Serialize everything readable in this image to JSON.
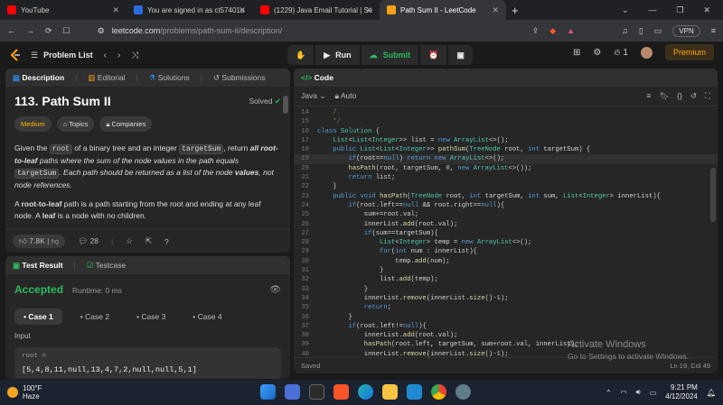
{
  "browser": {
    "tabs": [
      {
        "label": "YouTube",
        "color": "#ff0000"
      },
      {
        "label": "You are signed in as ct57401u",
        "color": "#2d6cdf"
      },
      {
        "label": "(1229) Java Email Tutorial | Sending ...",
        "color": "#ff0000"
      },
      {
        "label": "Path Sum II - LeetCode",
        "color": "#ffa116"
      }
    ],
    "new_tab": "+",
    "url_host": "leetcode.com",
    "url_path": "/problems/path-sum-ii/description/",
    "vpn_label": "VPN"
  },
  "lc_header": {
    "problem_list": "Problem List",
    "run_label": "Run",
    "submit_label": "Submit",
    "streak": "1",
    "premium": "Premium"
  },
  "left_tabs": {
    "description": "Description",
    "editorial": "Editorial",
    "solutions": "Solutions",
    "submissions": "Submissions"
  },
  "problem": {
    "title": "113. Path Sum II",
    "status": "Solved",
    "difficulty": "Medium",
    "topics": "Topics",
    "companies": "Companies",
    "p1_a": "Given the ",
    "p1_root": "root",
    "p1_b": " of a binary tree and an integer ",
    "p1_target": "targetSum",
    "p1_c": ", return ",
    "p1_d": "all root-to-leaf",
    "p1_e": " paths where the sum of the node values in the path equals ",
    "p1_target2": "targetSum",
    "p1_f": ". Each path should be returned as a list of the node ",
    "p1_g": "values",
    "p1_h": ", not node references.",
    "p2_a": "A ",
    "p2_b": "root-to-leaf",
    "p2_c": " path is a path starting from the root and ending at any leaf node. A ",
    "p2_d": "leaf",
    "p2_e": " is a node with no children.",
    "likes": "7.8K",
    "comments": "28"
  },
  "testpanel": {
    "tab_result": "Test Result",
    "tab_testcase": "Testcase",
    "verdict": "Accepted",
    "runtime": "Runtime: 0 ms",
    "cases": [
      "Case 1",
      "Case 2",
      "Case 3",
      "Case 4"
    ],
    "input_label": "Input",
    "input_name": "root =",
    "input_value": "[5,4,8,11,null,13,4,7,2,null,null,5,1]"
  },
  "editor": {
    "title": "Code",
    "language": "Java",
    "mode": "Auto",
    "saved": "Saved",
    "cursor": "Ln 19, Col 49"
  },
  "code_lines": [
    {
      "n": "14",
      "t": "    /"
    },
    {
      "n": "15",
      "t": "    */"
    },
    {
      "n": "16",
      "t": "class Solution {"
    },
    {
      "n": "17",
      "t": "    List<List<Integer>> list = new ArrayList<>();"
    },
    {
      "n": "18",
      "t": "    public List<List<Integer>> pathSum(TreeNode root, int targetSum) {"
    },
    {
      "n": "19",
      "t": "        if(root==null) return new ArrayList<>();"
    },
    {
      "n": "20",
      "t": "        hasPath(root, targetSum, 0, new ArrayList<>());"
    },
    {
      "n": "21",
      "t": "        return list;"
    },
    {
      "n": "22",
      "t": "    }"
    },
    {
      "n": "23",
      "t": "    public void hasPath(TreeNode root, int targetSum, int sum, List<Integer> innerList){"
    },
    {
      "n": "24",
      "t": "        if(root.left==null && root.right==null){"
    },
    {
      "n": "25",
      "t": "            sum+=root.val;"
    },
    {
      "n": "26",
      "t": "            innerList.add(root.val);"
    },
    {
      "n": "27",
      "t": "            if(sum==targetSum){"
    },
    {
      "n": "28",
      "t": "                List<Integer> temp = new ArrayList<>();"
    },
    {
      "n": "29",
      "t": "                for(int num : innerList){"
    },
    {
      "n": "30",
      "t": "                    temp.add(num);"
    },
    {
      "n": "31",
      "t": "                }"
    },
    {
      "n": "32",
      "t": "                list.add(temp);"
    },
    {
      "n": "33",
      "t": "            }"
    },
    {
      "n": "34",
      "t": "            innerList.remove(innerList.size()-1);"
    },
    {
      "n": "35",
      "t": "            return;"
    },
    {
      "n": "36",
      "t": "        }"
    },
    {
      "n": "37",
      "t": "        if(root.left!=null){"
    },
    {
      "n": "38",
      "t": "            innerList.add(root.val);"
    },
    {
      "n": "39",
      "t": "            hasPath(root.left, targetSum, sum+root.val, innerList);"
    },
    {
      "n": "40",
      "t": "            innerList.remove(innerList.size()-1);"
    }
  ],
  "watermark": {
    "line1": "Activate Windows",
    "line2": "Go to Settings to activate Windows."
  },
  "taskbar": {
    "temp": "100°F",
    "weather": "Haze",
    "time": "9:21 PM",
    "date": "4/12/2024"
  },
  "colors": {
    "accent": "#ffa116",
    "accepted": "#2cbb5d"
  }
}
